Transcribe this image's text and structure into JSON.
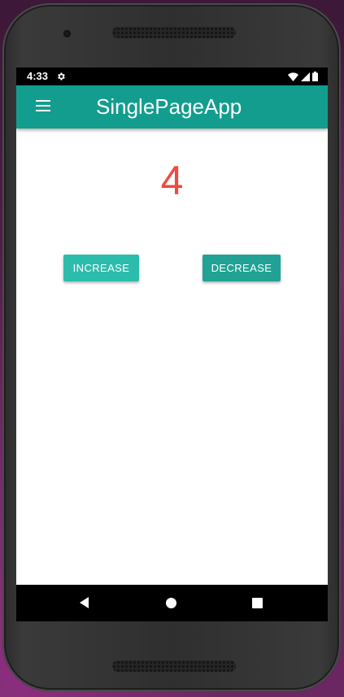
{
  "status_bar": {
    "time": "4:33",
    "icons": [
      "settings-gear-icon",
      "wifi-icon",
      "cellular-signal-icon",
      "battery-icon"
    ]
  },
  "toolbar": {
    "menu_icon": "hamburger-menu-icon",
    "title": "SinglePageApp",
    "color": "#129d8f"
  },
  "counter": {
    "value": "4",
    "color": "#ee4b3c"
  },
  "buttons": {
    "increase_label": "INCREASE",
    "decrease_label": "DECREASE",
    "accent": "#2cbcac"
  },
  "nav_bar": {
    "icons": [
      "back-icon",
      "home-icon",
      "recents-icon"
    ]
  }
}
